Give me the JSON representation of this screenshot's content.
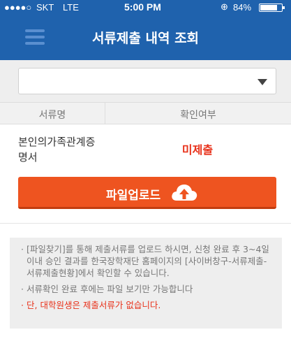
{
  "status_bar": {
    "signal": "●●●●○",
    "carrier": "SKT",
    "network": "LTE",
    "time": "5:00 PM",
    "alarm_icon": "alarm-icon",
    "battery_text": "84%",
    "battery_level": 0.84
  },
  "header": {
    "title": "서류제출 내역 조회",
    "menu_icon": "hamburger-menu-icon",
    "color": "#1f62ad"
  },
  "select": {
    "value": "",
    "arrow_icon": "dropdown-arrow-icon"
  },
  "table": {
    "headers": [
      "서류명",
      "확인여부"
    ],
    "rows": [
      {
        "name": "본인의가족관계증명서",
        "name_line1": "본인의가족관계증",
        "name_line2": "명서",
        "status": "미제출",
        "status_color": "#e8311a"
      }
    ]
  },
  "upload": {
    "label": "파일업로드",
    "icon": "cloud-upload-icon",
    "color": "#ee5420"
  },
  "notice": {
    "items": [
      "[파일찾기]를 통해 제출서류를 업로드 하시면, 신청 완료 후 3~4일 이내 승인 결과를 한국장학재단 홈페이지의 [사이버창구-서류제출-서류제출현황]에서 확인할 수 있습니다.",
      "서류확인 완료 후에는 파일 보기만 가능합니다",
      "단, 대학원생은 제출서류가 없습니다."
    ],
    "warning_color": "#e8311a"
  }
}
